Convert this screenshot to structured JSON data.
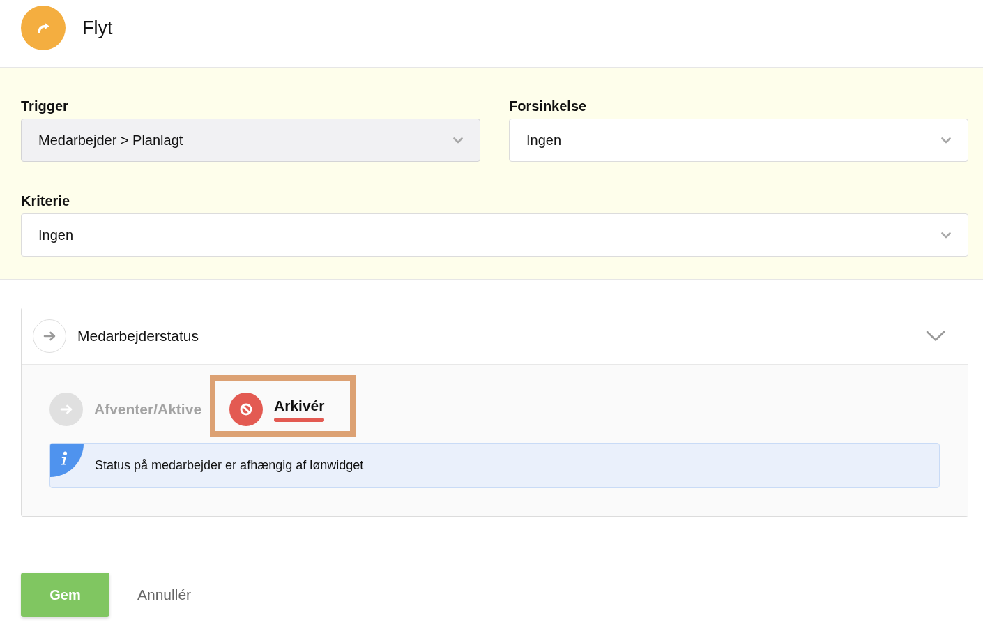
{
  "header": {
    "title": "Flyt"
  },
  "form": {
    "rows": [
      [
        {
          "label": "Trigger",
          "value": "Medarbejder > Planlagt",
          "disabled": true
        },
        {
          "label": "Forsinkelse",
          "value": "Ingen",
          "disabled": false
        }
      ],
      [
        {
          "label": "Kriterie",
          "value": "Ingen",
          "disabled": false
        }
      ]
    ]
  },
  "action_card": {
    "title": "Medarbejderstatus",
    "expanded": true,
    "options": [
      {
        "label": "Afventer/Aktive",
        "kind": "move",
        "selected": false,
        "highlighted": false
      },
      {
        "label": "Arkivér",
        "kind": "archive",
        "selected": true,
        "highlighted": true
      }
    ],
    "info": "Status på medarbejder er afhængig af lønwidget"
  },
  "buttons": [
    {
      "label": "Gem",
      "kind": "primary"
    },
    {
      "label": "Annullér",
      "kind": "link"
    }
  ]
}
